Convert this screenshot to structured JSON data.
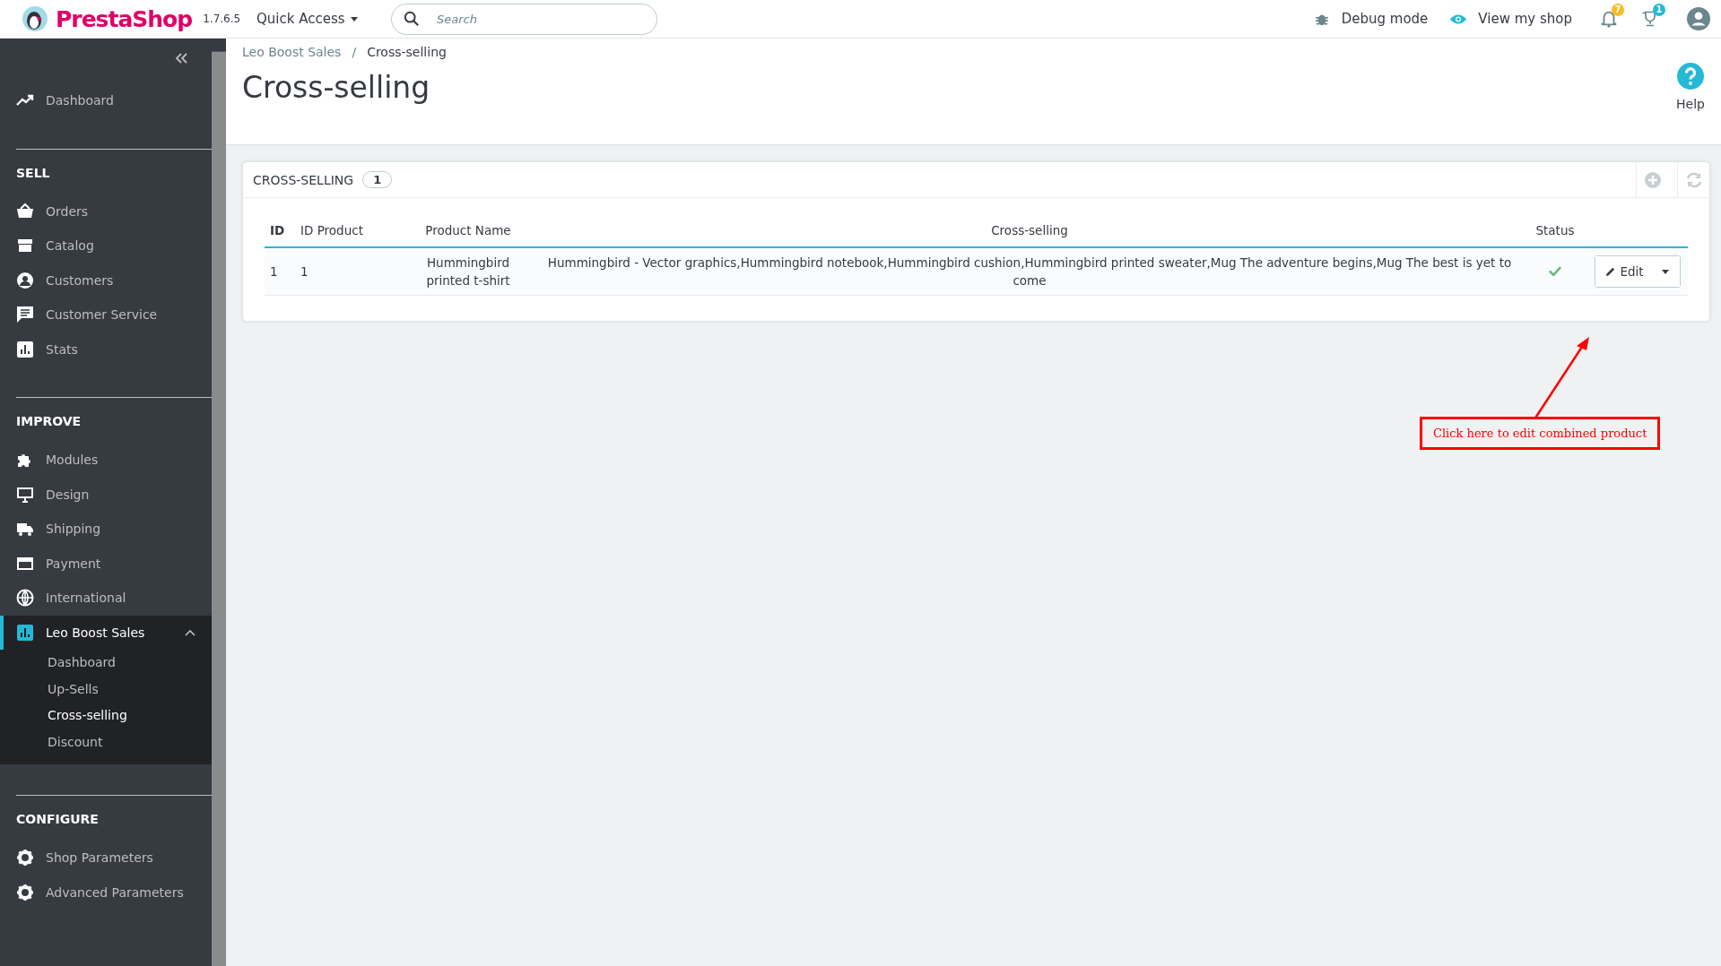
{
  "header": {
    "brand": "PrestaShop",
    "version": "1.7.6.5",
    "quick_access": "Quick Access",
    "search": {
      "placeholder": "Search"
    },
    "debug": "Debug mode",
    "view_shop": "View my shop",
    "notifications_count": "7",
    "trophy_count": "1"
  },
  "sidebar": {
    "top_items": [
      {
        "label": "Dashboard",
        "selected": false
      }
    ],
    "sections": [
      {
        "title": "SELL",
        "items": [
          {
            "label": "Orders",
            "selected": false,
            "expanded": false
          },
          {
            "label": "Catalog",
            "selected": false,
            "expanded": false
          },
          {
            "label": "Customers",
            "selected": false,
            "expanded": false
          },
          {
            "label": "Customer Service",
            "selected": false,
            "expanded": false
          },
          {
            "label": "Stats",
            "selected": false,
            "expanded": false
          }
        ]
      },
      {
        "title": "IMPROVE",
        "items": [
          {
            "label": "Modules",
            "selected": false,
            "expanded": false
          },
          {
            "label": "Design",
            "selected": false,
            "expanded": false
          },
          {
            "label": "Shipping",
            "selected": false,
            "expanded": false
          },
          {
            "label": "Payment",
            "selected": false,
            "expanded": false
          },
          {
            "label": "International",
            "selected": false,
            "expanded": false
          },
          {
            "label": "Leo Boost Sales",
            "selected": true,
            "expanded": true,
            "children": [
              {
                "label": "Dashboard",
                "selected": false
              },
              {
                "label": "Up-Sells",
                "selected": false
              },
              {
                "label": "Cross-selling",
                "selected": true
              },
              {
                "label": "Discount",
                "selected": false
              }
            ]
          }
        ]
      },
      {
        "title": "CONFIGURE",
        "items": [
          {
            "label": "Shop Parameters",
            "selected": false,
            "expanded": false
          },
          {
            "label": "Advanced Parameters",
            "selected": false,
            "expanded": false
          }
        ]
      }
    ]
  },
  "breadcrumb": [
    "Leo Boost Sales",
    "Cross-selling"
  ],
  "breadcrumb_separator": "/",
  "page_title": "Cross-selling",
  "help": "Help",
  "panel": {
    "title": "CROSS-SELLING",
    "count": "1",
    "table": {
      "columns": [
        "ID",
        "ID Product",
        "Product Name",
        "Cross-selling",
        "Status"
      ],
      "rows": [
        {
          "id": "1",
          "id_product": "1",
          "product_name": "Hummingbird printed t-shirt",
          "cross_selling": "Hummingbird - Vector graphics,Hummingbird notebook,Hummingbird cushion,Hummingbird printed sweater,Mug The adventure begins,Mug The best is yet to come",
          "status": true,
          "action": "Edit"
        }
      ]
    }
  },
  "annotation": "Click here to edit combined product"
}
